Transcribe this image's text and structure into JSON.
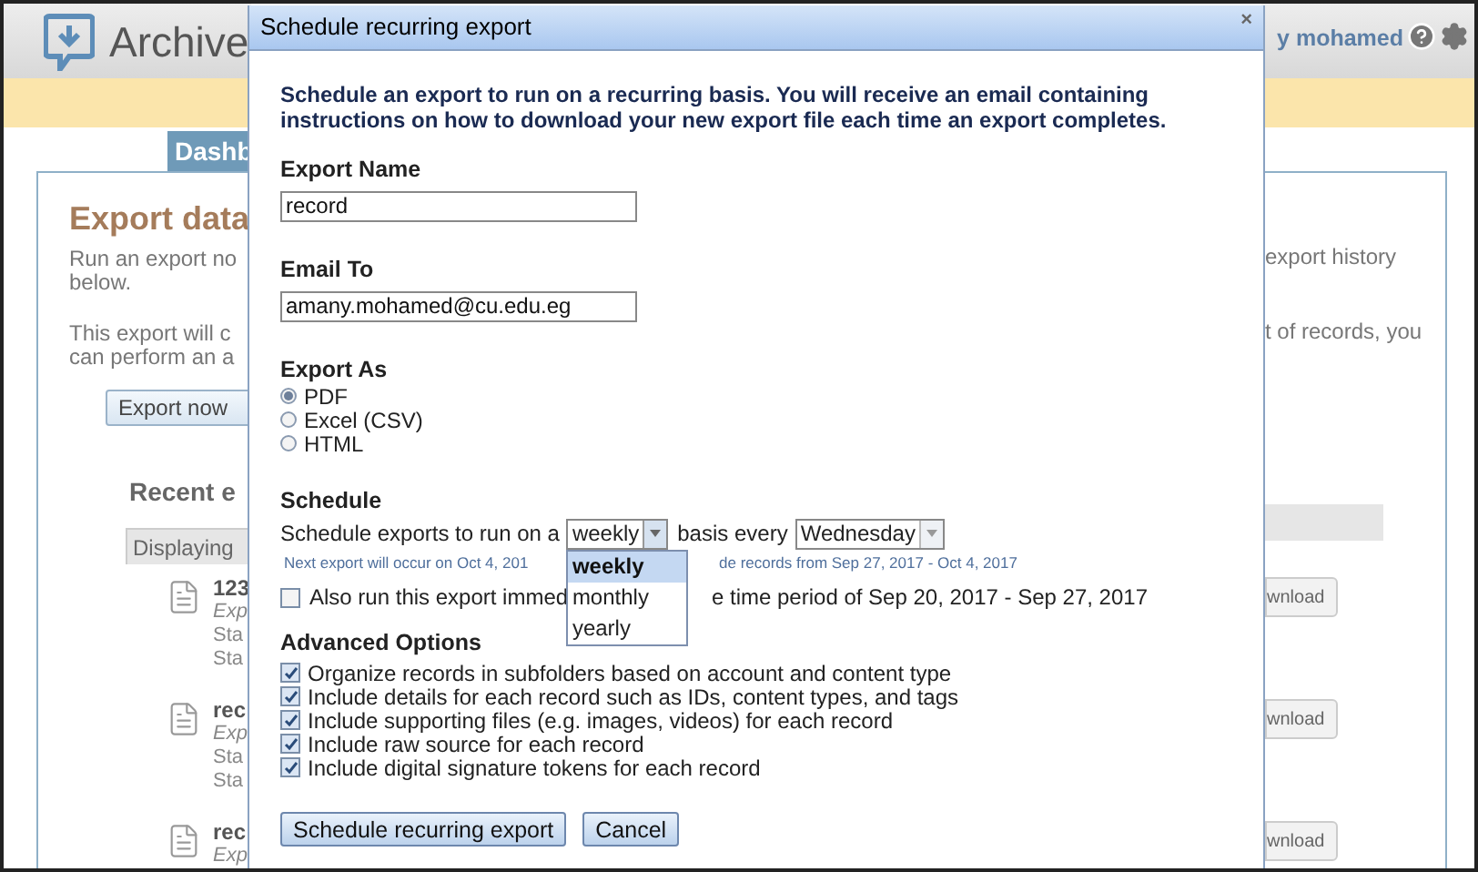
{
  "header": {
    "logo_text": "Archive",
    "user": "y mohamed"
  },
  "tab": {
    "label": "Dashb",
    "selected": true
  },
  "left": {
    "title": "Export data",
    "paragraphs": [
      [
        "Run an export no",
        "below."
      ],
      [
        "This export will c",
        "can perform an a"
      ]
    ],
    "export_button": "Export now",
    "recent_title": "Recent e",
    "table_header": "Displaying",
    "records": [
      {
        "name": "123",
        "lines": [
          {
            "kind": "type",
            "text": "Exp"
          },
          {
            "kind": "status",
            "text": "Sta"
          },
          {
            "kind": "status",
            "text": "Sta"
          }
        ]
      },
      {
        "name": "rec",
        "lines": [
          {
            "kind": "type",
            "text": "Exp"
          },
          {
            "kind": "status",
            "text": "Sta"
          },
          {
            "kind": "status",
            "text": "Sta"
          }
        ]
      },
      {
        "name": "rec",
        "lines": [
          {
            "kind": "type",
            "text": "Exp"
          }
        ]
      }
    ]
  },
  "right": {
    "paragraphs": [
      "export history",
      "t of records, you"
    ],
    "download_buttons": [
      "wnload",
      "wnload",
      "wnload"
    ]
  },
  "dialog": {
    "title": "Schedule recurring export",
    "close": "×",
    "intro": "Schedule an export to run on a recurring basis. You will receive an email containing instructions on how to download your new export file each time an export completes.",
    "fields": [
      {
        "label": "Export Name",
        "value": "record"
      },
      {
        "label": "Email To",
        "value": "amany.mohamed@cu.edu.eg"
      }
    ],
    "export_as": {
      "label": "Export As",
      "options": [
        {
          "label": "PDF",
          "selected": true
        },
        {
          "label": "Excel (CSV)",
          "selected": false
        },
        {
          "label": "HTML",
          "selected": false
        }
      ]
    },
    "schedule": {
      "label": "Schedule",
      "prefix": "Schedule exports to run on a",
      "frequency": "weekly",
      "middle": "basis every",
      "day": "Wednesday",
      "note_parts": [
        "Next export will occur on Oct 4, 201",
        "de records from Sep 27, 2017 - Oct 4, 2017"
      ],
      "also_run": {
        "checked": false,
        "parts": [
          "Also run this export immed",
          "e time period of Sep 20, 2017 - Sep 27, 2017"
        ]
      },
      "dropdown": {
        "expanded": true,
        "options": [
          {
            "label": "weekly",
            "selected": true
          },
          {
            "label": "monthly",
            "selected": false
          },
          {
            "label": "yearly",
            "selected": false
          }
        ]
      }
    },
    "advanced": {
      "label": "Advanced Options",
      "options": [
        {
          "label": "Organize records in subfolders based on account and content type",
          "checked": true
        },
        {
          "label": "Include details for each record such as IDs, content types, and tags",
          "checked": true
        },
        {
          "label": "Include supporting files (e.g. images, videos) for each record",
          "checked": true
        },
        {
          "label": "Include raw source for each record",
          "checked": true
        },
        {
          "label": "Include digital signature tokens for each record",
          "checked": true
        }
      ]
    },
    "buttons": [
      "Schedule recurring export",
      "Cancel"
    ]
  }
}
